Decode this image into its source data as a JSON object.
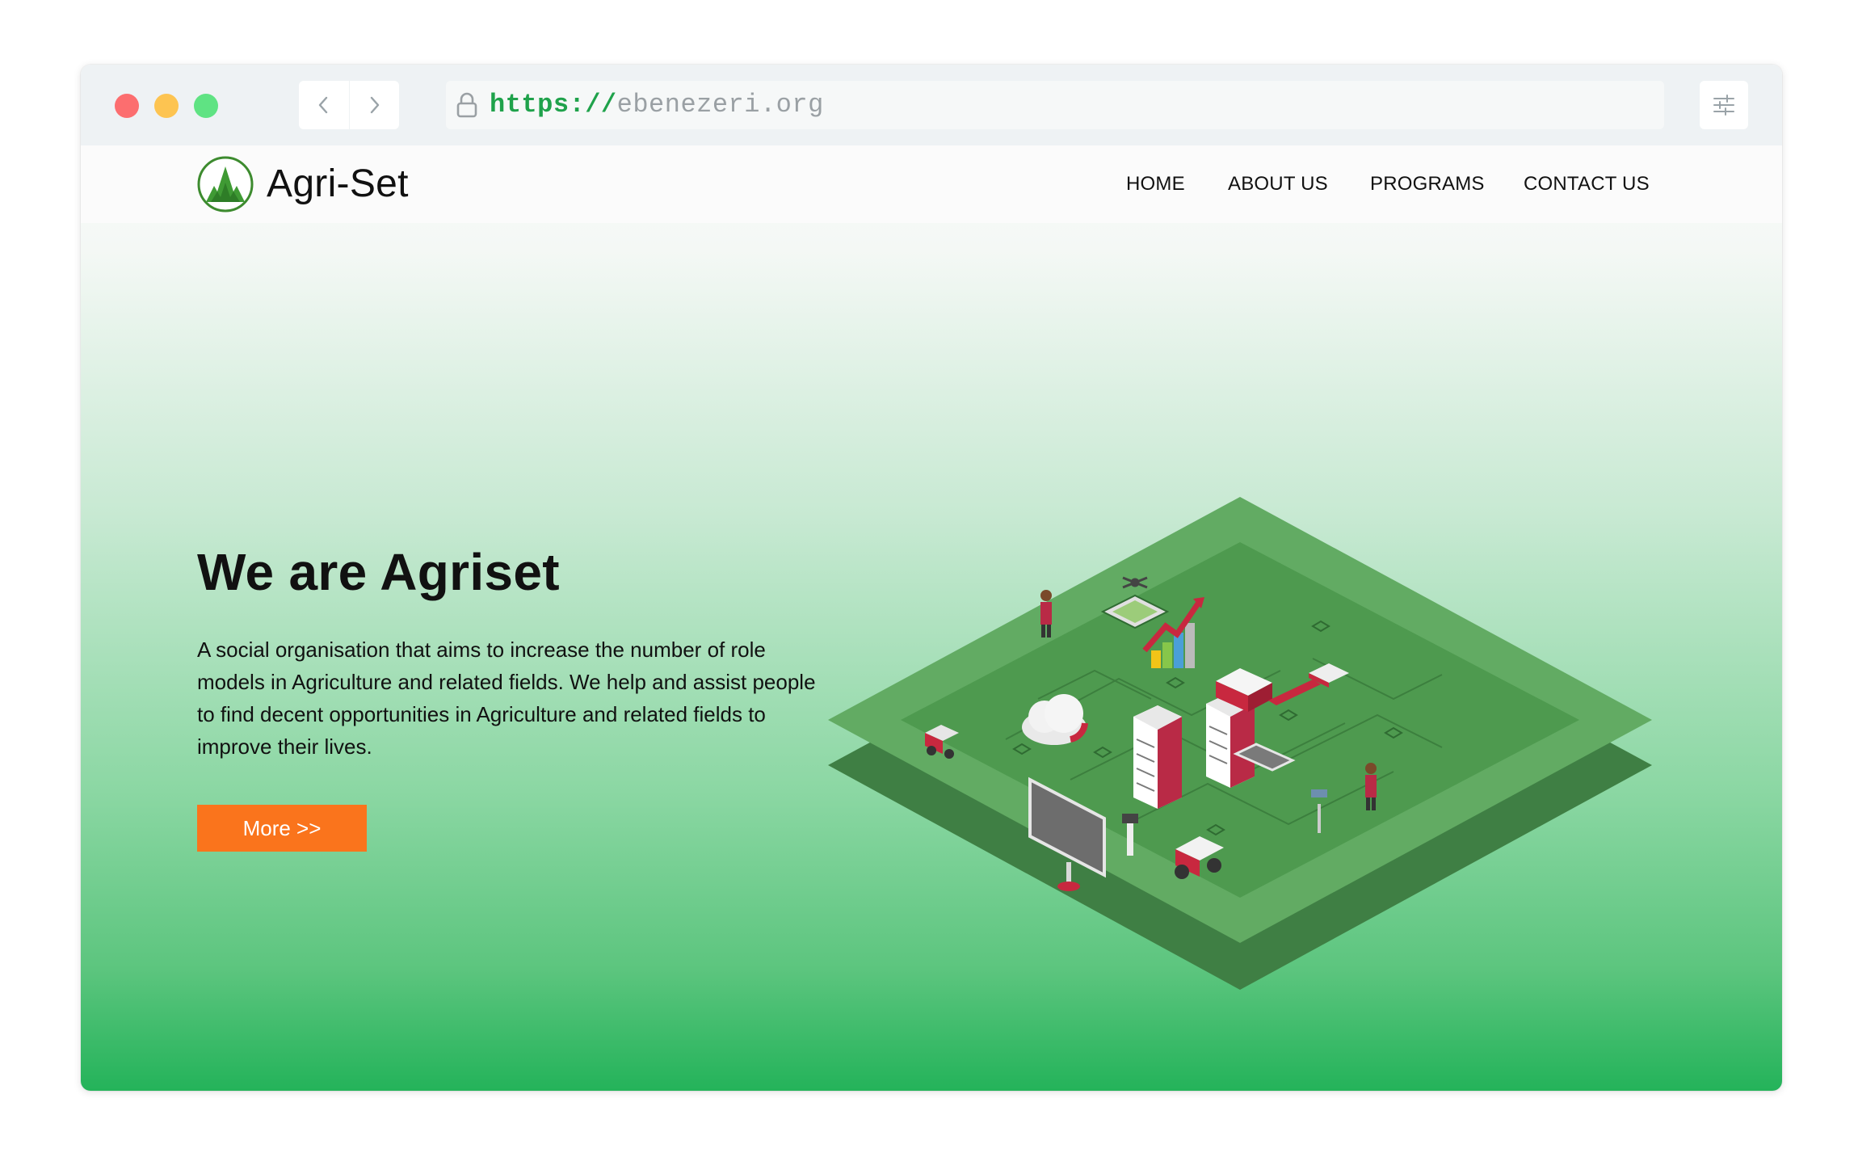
{
  "browser": {
    "url_scheme": "https://",
    "url_host": "ebenezeri.org"
  },
  "site": {
    "brand": "Agri-Set",
    "nav": [
      {
        "label": "HOME"
      },
      {
        "label": "ABOUT US"
      },
      {
        "label": "PROGRAMS"
      },
      {
        "label": "CONTACT US"
      }
    ]
  },
  "hero": {
    "title": "We are Agriset",
    "description": "A social organisation that aims to increase the number of role models in Agriculture and related fields. We help and assist people to find decent opportunities in Agriculture and related fields to improve their lives.",
    "cta_label": "More >>"
  },
  "icons": {
    "back": "chevron-left-icon",
    "forward": "chevron-right-icon",
    "lock": "lock-icon",
    "settings": "sliders-icon",
    "logo": "tree-logo-icon"
  },
  "colors": {
    "accent_orange": "#fa741c",
    "brand_green": "#24b35a",
    "url_green": "#1fa24b"
  }
}
